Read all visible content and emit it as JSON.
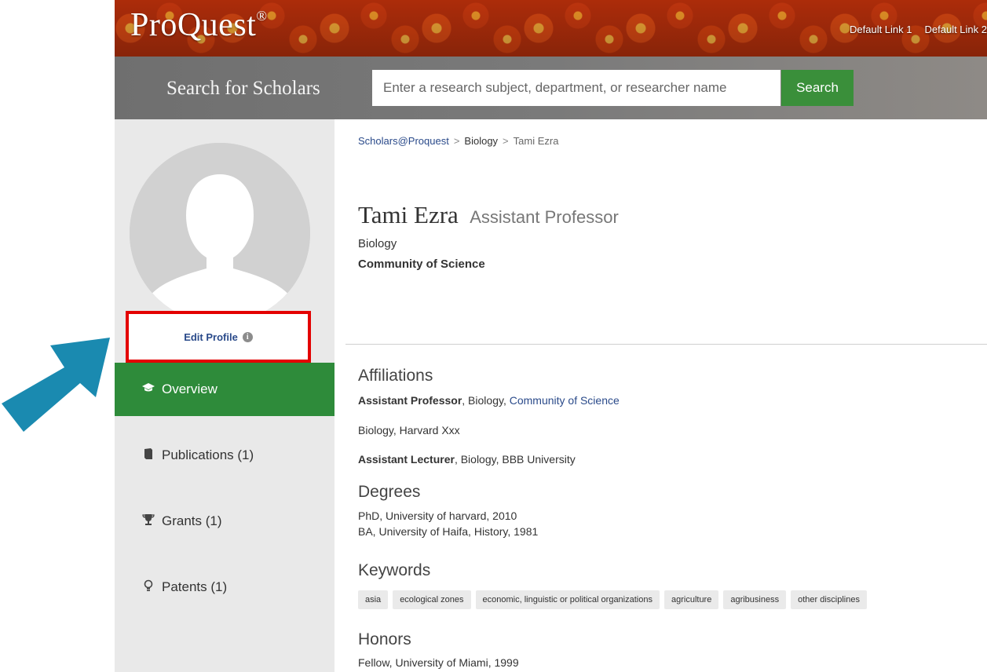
{
  "header": {
    "logo": "ProQuest",
    "logo_mark": "®",
    "links": [
      "Default Link 1",
      "Default Link 2"
    ]
  },
  "search": {
    "title": "Search for Scholars",
    "placeholder": "Enter a research subject, department, or researcher name",
    "button_label": "Search"
  },
  "sidebar": {
    "edit_profile_label": "Edit Profile",
    "info_icon": "info-icon",
    "items": [
      {
        "label": "Overview",
        "icon": "graduation-cap-icon",
        "glyph": "🎓",
        "active": true
      },
      {
        "label": "Publications (1)",
        "icon": "book-icon",
        "glyph": "📕",
        "active": false
      },
      {
        "label": "Grants (1)",
        "icon": "trophy-icon",
        "glyph": "🏆",
        "active": false
      },
      {
        "label": "Patents (1)",
        "icon": "lightbulb-icon",
        "glyph": "💡",
        "active": false
      }
    ]
  },
  "breadcrumb": {
    "items": [
      "Scholars@Proquest",
      "Biology",
      "Tami Ezra"
    ],
    "separator": ">"
  },
  "profile": {
    "name": "Tami Ezra",
    "rank": "Assistant Professor",
    "department": "Biology",
    "organization": "Community of Science"
  },
  "affiliations": {
    "heading": "Affiliations",
    "entries": [
      {
        "role": "Assistant Professor",
        "rest": ", Biology, ",
        "link": "Community of Science"
      },
      {
        "role": "",
        "rest": "Biology, Harvard Xxx",
        "link": ""
      },
      {
        "role": "Assistant Lecturer",
        "rest": ", Biology, BBB University",
        "link": ""
      }
    ]
  },
  "degrees": {
    "heading": "Degrees",
    "entries": [
      "PhD, University of harvard, 2010",
      "BA, University of Haifa, History, 1981"
    ]
  },
  "keywords": {
    "heading": "Keywords",
    "tags": [
      "asia",
      "ecological zones",
      "economic, linguistic or political organizations",
      "agriculture",
      "agribusiness",
      "other disciplines"
    ]
  },
  "honors": {
    "heading": "Honors",
    "entries": [
      "Fellow, University of Miami, 1999"
    ]
  },
  "colors": {
    "accent_green": "#2e8b3a",
    "link_blue": "#2a4a8a",
    "highlight_red": "#e30000",
    "arrow_blue": "#1a8ab0"
  }
}
